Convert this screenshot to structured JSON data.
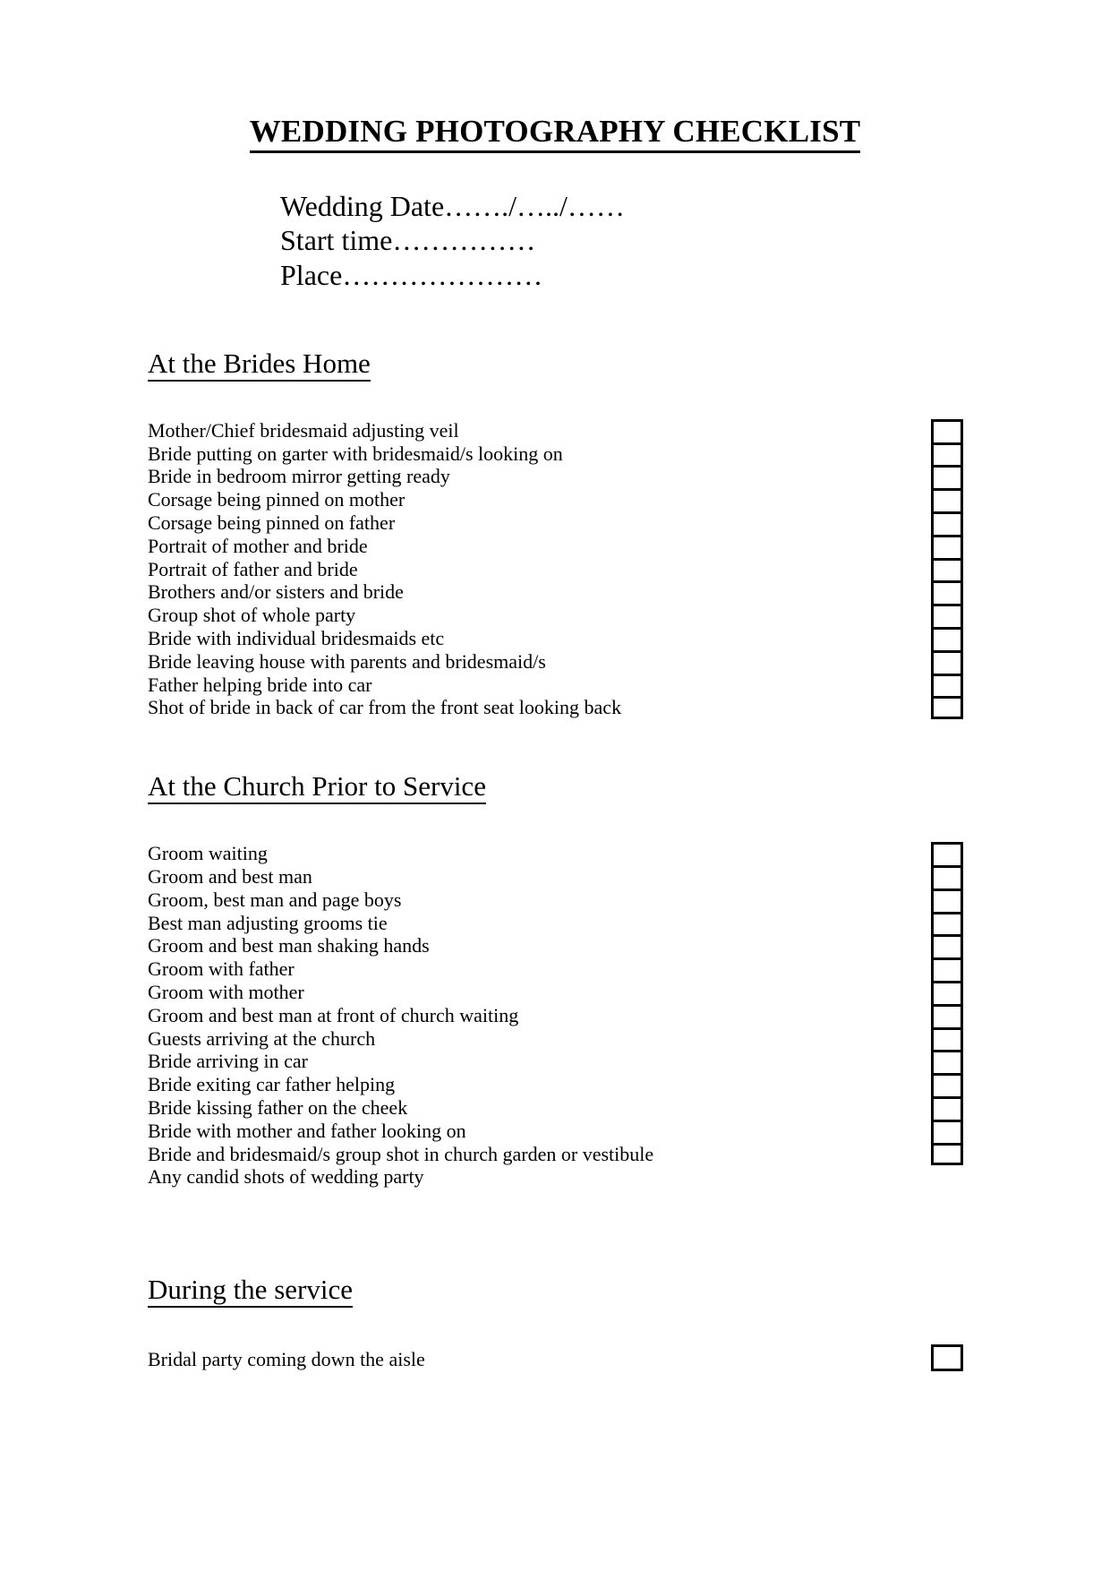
{
  "document": {
    "title": "WEDDING PHOTOGRAPHY CHECKLIST",
    "header_fields": [
      "Wedding Date……./…../……",
      "Start time……………",
      "Place…………………"
    ],
    "sections": [
      {
        "heading": "At the Brides Home",
        "items": [
          "Mother/Chief bridesmaid adjusting veil",
          "Bride putting on garter with bridesmaid/s looking on",
          "Bride in bedroom mirror getting ready",
          "Corsage being pinned on mother",
          "Corsage being pinned on father",
          "Portrait of mother and bride",
          "Portrait of father and bride",
          "Brothers and/or sisters and bride",
          "Group shot of whole party",
          "Bride with individual bridesmaids etc",
          "Bride leaving house with parents and bridesmaid/s",
          "Father helping bride into car",
          "Shot of bride in back of car from the front seat looking back"
        ],
        "checkbox_count": 13
      },
      {
        "heading": "At the Church Prior to Service",
        "items": [
          "Groom waiting",
          "Groom and best man",
          "Groom, best man and page boys",
          "Best man adjusting grooms tie",
          "Groom and best man shaking hands",
          "Groom with father",
          "Groom with mother",
          "Groom and best man at front of church waiting",
          "Guests arriving at the church",
          "Bride arriving in car",
          "Bride exiting car father helping",
          "Bride kissing father on the cheek",
          "Bride with mother and father looking on",
          "Bride and bridesmaid/s group shot in church garden or vestibule",
          "Any candid shots of wedding party"
        ],
        "checkbox_count": 14
      },
      {
        "heading": "During the service",
        "items": [
          "Bridal party coming down the aisle"
        ],
        "checkbox_count": 1
      }
    ]
  },
  "colors": {
    "text": "#000000",
    "background": "#ffffff",
    "rule": "#000000"
  }
}
